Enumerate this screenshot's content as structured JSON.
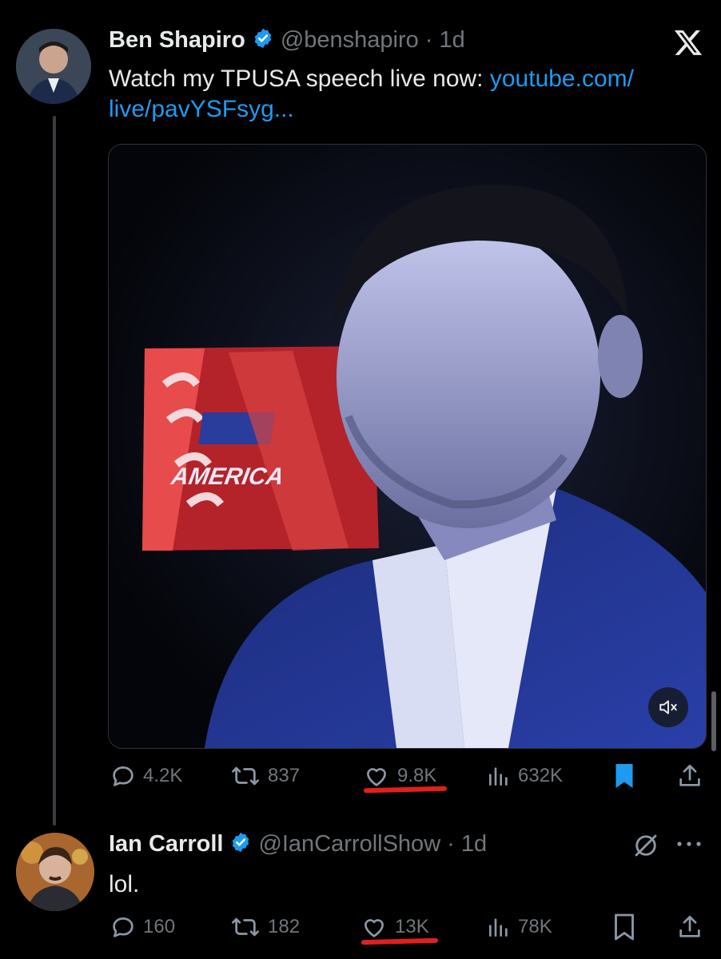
{
  "tweet1": {
    "name": "Ben Shapiro",
    "handle": "@benshapiro",
    "time": "· 1d",
    "text": "Watch my TPUSA speech live now: ",
    "link": "youtube.com/\nlive/pavYSFsyg...",
    "link_line1": "youtube.com/",
    "link_line2": "live/pavYSFsyg...",
    "media_text": "AMERICA",
    "actions": {
      "replies": "4.2K",
      "reposts": "837",
      "likes": "9.8K",
      "views": "632K"
    },
    "bookmarked": true
  },
  "tweet2": {
    "name": "Ian Carroll",
    "handle": "@IanCarrollShow",
    "time": "· 1d",
    "text": "lol.",
    "actions": {
      "replies": "160",
      "reposts": "182",
      "likes": "13K",
      "views": "78K"
    },
    "bookmarked": false
  },
  "icons": {
    "platform": "x-logo-icon",
    "verified": "verified-badge-icon",
    "mute": "speaker-muted-icon"
  },
  "colors": {
    "background": "#000000",
    "accent": "#1d9bf0",
    "muted": "#71767b",
    "annotation": "#e0201e"
  }
}
